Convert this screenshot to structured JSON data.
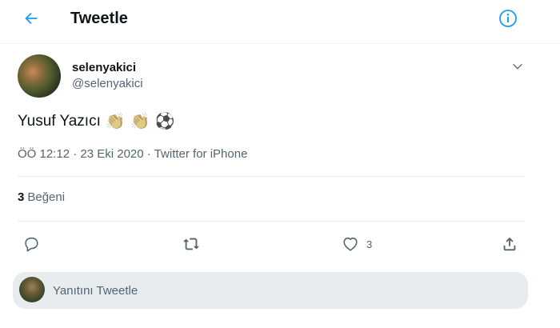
{
  "header": {
    "title": "Tweetle",
    "back_icon": "arrow-left-icon",
    "info_icon": "info-icon"
  },
  "tweet": {
    "author": {
      "display_name": "selenyakici",
      "handle": "@selenyakici"
    },
    "text": "Yusuf Yazıcı",
    "emojis": [
      "👏",
      "👏",
      "⚽"
    ],
    "time": "ÖÖ 12:12",
    "date": "23 Eki 2020",
    "separator": "·",
    "source": "Twitter for iPhone"
  },
  "stats": {
    "likes_count": "3",
    "likes_label": "Beğeni"
  },
  "actions": {
    "reply_icon": "reply-icon",
    "retweet_icon": "retweet-icon",
    "like_icon": "heart-icon",
    "like_count": "3",
    "share_icon": "share-icon"
  },
  "reply": {
    "placeholder": "Yanıtını Tweetle"
  },
  "colors": {
    "accent": "#1d9bf0",
    "muted": "#536471",
    "divider": "#e6ecf0",
    "reply_bg": "#e8ecef"
  }
}
